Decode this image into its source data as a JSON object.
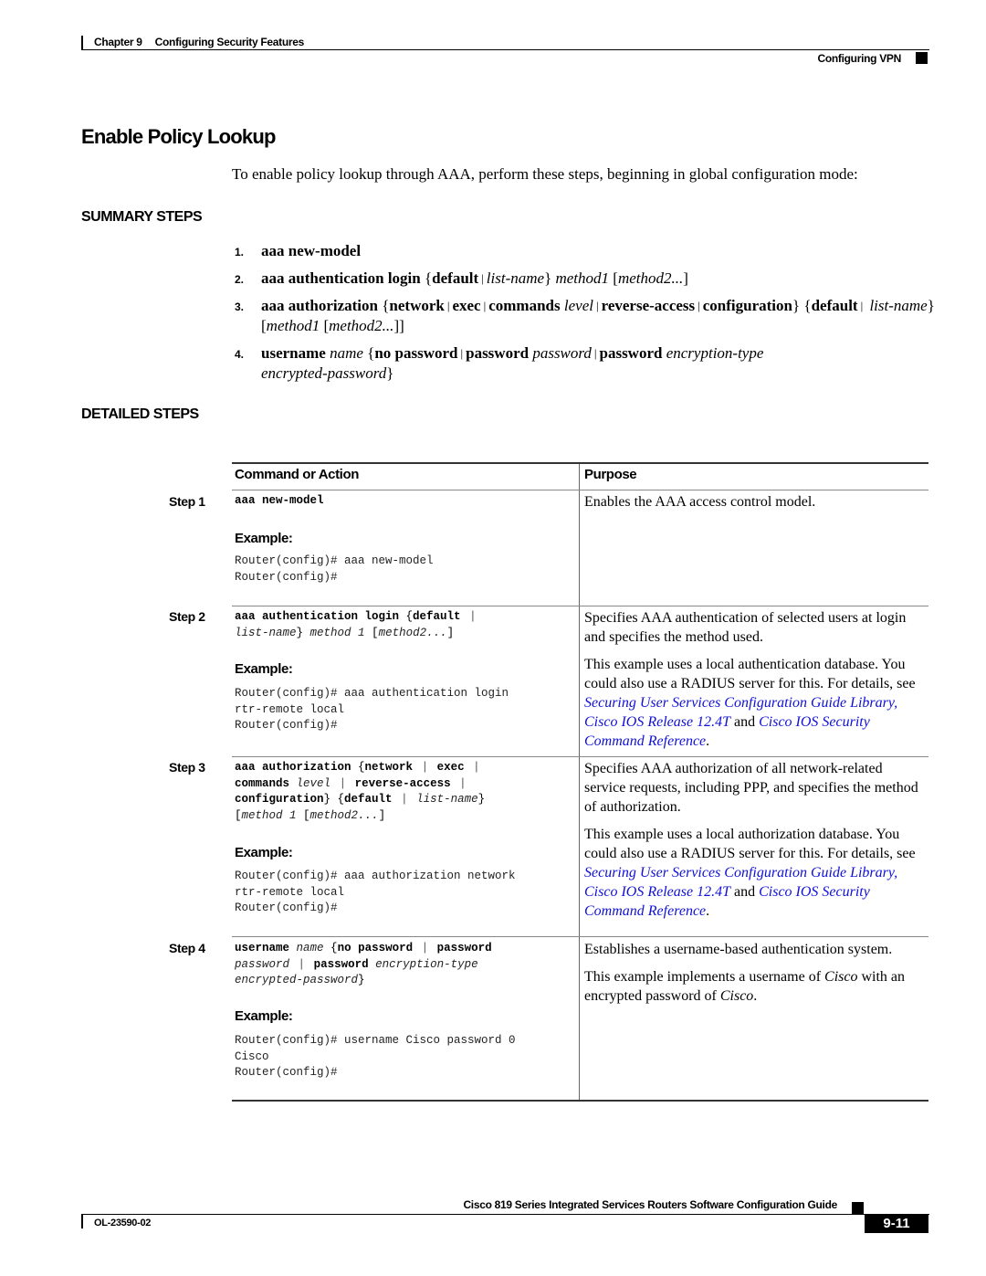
{
  "header": {
    "chapter_label": "Chapter 9",
    "chapter_title": "Configuring Security Features",
    "section": "Configuring VPN"
  },
  "title": "Enable Policy Lookup",
  "intro": "To enable policy lookup through AAA, perform these steps, beginning in global configuration mode:",
  "summary": {
    "heading": "SUMMARY STEPS",
    "items": [
      {
        "num": "1.",
        "line1": "aaa new-model"
      },
      {
        "num": "2."
      },
      {
        "num": "3."
      },
      {
        "num": "4."
      }
    ],
    "tokens": {
      "aaa_auth_login": "aaa authentication login",
      "aaa_authorization": "aaa authorization",
      "default": "default",
      "list_name": "list-name",
      "method1": "method1",
      "method2": "method2...",
      "network": "network",
      "exec": "exec",
      "commands": "commands",
      "level": "level",
      "reverse_access": "reverse-access",
      "configuration": "configuration",
      "username": "username",
      "name": "name",
      "no_password": "no password",
      "password_kw": "password",
      "password_arg": "password",
      "encryption_type": "encryption-type",
      "encrypted_password": "encrypted-password"
    }
  },
  "detailed": {
    "heading": "DETAILED STEPS",
    "col_command": "Command or Action",
    "col_purpose": "Purpose",
    "example_label": "Example:",
    "steps": [
      {
        "label": "Step 1",
        "cmd": "aaa new-model",
        "example": [
          "Router(config)# aaa new-model",
          "Router(config)#"
        ],
        "purpose": [
          "Enables the AAA access control model."
        ]
      },
      {
        "label": "Step 2",
        "cmd_parts": {
          "a": "aaa authentication login",
          "b": "default",
          "c": "list-name",
          "d": "method 1",
          "e": "method2..."
        },
        "example": [
          "Router(config)# aaa authentication login",
          "rtr-remote local",
          "Router(config)#"
        ],
        "purpose": [
          "Specifies AAA authentication of selected users at login and specifies the method used.",
          "This example uses a local authentication database. You could also use a RADIUS server for this. For details, see"
        ],
        "link1": "Securing User Services Configuration Guide Library, Cisco IOS Release 12.4T",
        "and": "and",
        "link2": "Cisco IOS Security Command Reference"
      },
      {
        "label": "Step 3",
        "cmd_parts": {
          "a": "aaa authorization",
          "b": "network",
          "c": "exec",
          "d": "commands",
          "e": "level",
          "f": "reverse-access",
          "g": "configuration",
          "h": "default",
          "i": "list-name",
          "j": "method 1",
          "k": "method2..."
        },
        "example": [
          "Router(config)# aaa authorization network",
          "rtr-remote local",
          "Router(config)#"
        ],
        "purpose": [
          "Specifies AAA authorization of all network-related service requests, including PPP, and specifies the method of authorization.",
          "This example uses a local authorization database. You could also use a RADIUS server for this. For details, see"
        ],
        "link1": "Securing User Services Configuration Guide Library, Cisco IOS Release 12.4T",
        "and": "and",
        "link2": "Cisco IOS Security Command Reference"
      },
      {
        "label": "Step 4",
        "cmd_parts": {
          "a": "username",
          "b": "name",
          "c": "no password",
          "d": "password",
          "e": "password",
          "f": "password",
          "g": "encryption-type",
          "h": "encrypted-password"
        },
        "example": [
          "Router(config)# username Cisco password 0",
          "Cisco",
          "Router(config)#"
        ],
        "purpose": [
          "Establishes a username-based authentication system."
        ],
        "purpose2_pre": "This example implements a username of",
        "purpose2_mid": "with an encrypted password of",
        "purpose2_name": "Cisco"
      }
    ]
  },
  "footer": {
    "guide_title": "Cisco 819 Series Integrated Services Routers Software Configuration Guide",
    "doc_number": "OL-23590-02",
    "page": "9-11"
  }
}
